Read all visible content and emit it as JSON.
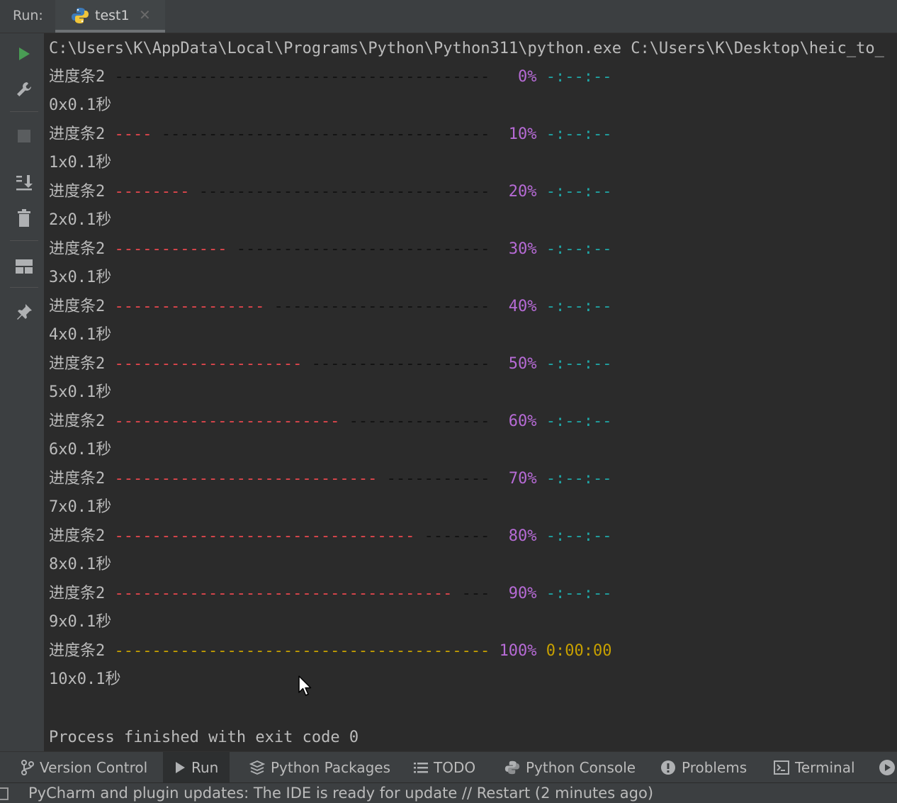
{
  "run": {
    "label": "Run:",
    "tab_name": "test1",
    "close_glyph": "✕"
  },
  "console": {
    "command": "C:\\Users\\K\\AppData\\Local\\Programs\\Python\\Python311\\python.exe C:\\Users\\K\\Desktop\\heic_to_",
    "progress_label": "进度条2",
    "eta_placeholder": "-:--:--",
    "steps": [
      {
        "progress": 0,
        "percent": "0%",
        "eta": "-:--:--",
        "done": false,
        "note": "0x0.1秒"
      },
      {
        "progress": 10,
        "percent": "10%",
        "eta": "-:--:--",
        "done": false,
        "note": "1x0.1秒"
      },
      {
        "progress": 20,
        "percent": "20%",
        "eta": "-:--:--",
        "done": false,
        "note": "2x0.1秒"
      },
      {
        "progress": 30,
        "percent": "30%",
        "eta": "-:--:--",
        "done": false,
        "note": "3x0.1秒"
      },
      {
        "progress": 40,
        "percent": "40%",
        "eta": "-:--:--",
        "done": false,
        "note": "4x0.1秒"
      },
      {
        "progress": 50,
        "percent": "50%",
        "eta": "-:--:--",
        "done": false,
        "note": "5x0.1秒"
      },
      {
        "progress": 60,
        "percent": "60%",
        "eta": "-:--:--",
        "done": false,
        "note": "6x0.1秒"
      },
      {
        "progress": 70,
        "percent": "70%",
        "eta": "-:--:--",
        "done": false,
        "note": "7x0.1秒"
      },
      {
        "progress": 80,
        "percent": "80%",
        "eta": "-:--:--",
        "done": false,
        "note": "8x0.1秒"
      },
      {
        "progress": 90,
        "percent": "90%",
        "eta": "-:--:--",
        "done": false,
        "note": "9x0.1秒"
      },
      {
        "progress": 100,
        "percent": "100%",
        "eta": "0:00:00",
        "done": true,
        "note": "10x0.1秒"
      }
    ],
    "exit_message": "Process finished with exit code 0"
  },
  "colors": {
    "bar_done": "#e5474d",
    "bar_todo": "#111111",
    "bar_complete": "#c7a000",
    "percent": "#b76bd6",
    "eta": "#1fa7a7"
  },
  "bottom_tabs": [
    {
      "label": "Version Control",
      "icon": "branch-icon"
    },
    {
      "label": "Run",
      "icon": "play-icon",
      "active": true
    },
    {
      "label": "Python Packages",
      "icon": "layers-icon"
    },
    {
      "label": "TODO",
      "icon": "list-icon"
    },
    {
      "label": "Python Console",
      "icon": "python-icon"
    },
    {
      "label": "Problems",
      "icon": "warning-icon"
    },
    {
      "label": "Terminal",
      "icon": "terminal-icon"
    }
  ],
  "status": {
    "message": "PyCharm and plugin updates: The IDE is ready for update // Restart (2 minutes ago)"
  }
}
